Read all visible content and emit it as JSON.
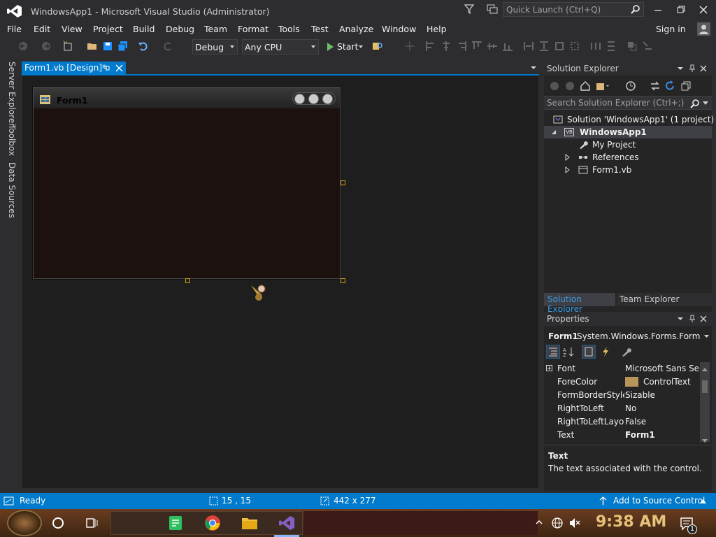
{
  "window": {
    "title": "WindowsApp1 - Microsoft Visual Studio  (Administrator)",
    "quick_launch_placeholder": "Quick Launch (Ctrl+Q)"
  },
  "menu": [
    "File",
    "Edit",
    "View",
    "Project",
    "Build",
    "Debug",
    "Team",
    "Format",
    "Tools",
    "Test",
    "Analyze",
    "Window",
    "Help"
  ],
  "account": {
    "sign_in": "Sign in"
  },
  "toolbar": {
    "configuration": "Debug",
    "platform": "Any CPU",
    "start_label": "Start"
  },
  "left_tabs": [
    "Server Explorer",
    "Toolbox",
    "Data Sources"
  ],
  "document": {
    "tab_label": "Form1.vb [Design]*",
    "form_title": "Form1"
  },
  "solution_explorer": {
    "title": "Solution Explorer",
    "search_placeholder": "Search Solution Explorer (Ctrl+;)",
    "tree": {
      "solution": "Solution 'WindowsApp1' (1 project)",
      "project": "WindowsApp1",
      "project_badge": "VB",
      "items": [
        "My Project",
        "References",
        "Form1.vb"
      ]
    },
    "bottom_tabs": [
      "Solution Explorer",
      "Team Explorer"
    ]
  },
  "properties": {
    "title": "Properties",
    "object_name": "Form1",
    "object_type": "System.Windows.Forms.Form",
    "rows": [
      {
        "name": "Font",
        "value": "Microsoft Sans Serif",
        "expandable": true
      },
      {
        "name": "ForeColor",
        "value": "ControlText",
        "swatch": "#b8965a"
      },
      {
        "name": "FormBorderStyle",
        "value": "Sizable"
      },
      {
        "name": "RightToLeft",
        "value": "No"
      },
      {
        "name": "RightToLeftLayout",
        "value": "False"
      },
      {
        "name": "Text",
        "value": "Form1",
        "bold": true
      }
    ],
    "description_title": "Text",
    "description_text": "The text associated with the control."
  },
  "status_bar": {
    "state": "Ready",
    "position": "15 , 15",
    "size": "442 x 277",
    "source_control": "Add to Source Control"
  },
  "taskbar": {
    "clock": "9:38 AM",
    "notification_count": "1"
  },
  "colors": {
    "accent": "#007acc",
    "background": "#2d2d30",
    "designer": "#1e1e1e",
    "vs_purple": "#865fc5"
  }
}
